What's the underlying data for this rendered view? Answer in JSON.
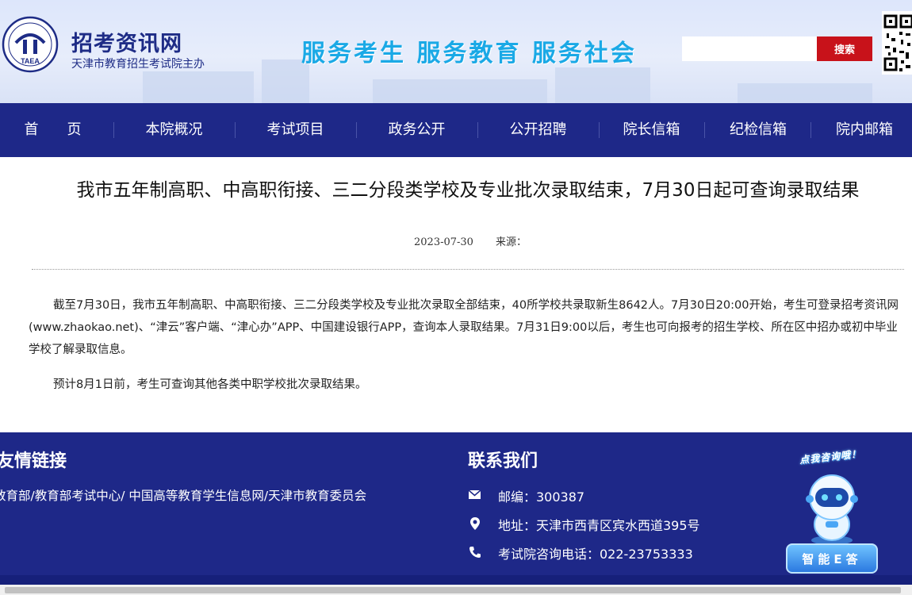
{
  "header": {
    "site_name": "招考资讯网",
    "site_subtitle": "天津市教育招生考试院主办",
    "logo_text": "TAEA",
    "slogan": "服务考生  服务教育  服务社会",
    "search": {
      "placeholder": "",
      "button_label": "搜索"
    }
  },
  "nav": {
    "items": [
      {
        "label": "首　　页"
      },
      {
        "label": "本院概况"
      },
      {
        "label": "考试项目"
      },
      {
        "label": "政务公开"
      },
      {
        "label": "公开招聘"
      },
      {
        "label": "院长信箱"
      },
      {
        "label": "纪检信箱"
      },
      {
        "label": "院内邮箱"
      }
    ]
  },
  "article": {
    "title": "我市五年制高职、中高职衔接、三二分段类学校及专业批次录取结束，7月30日起可查询录取结果",
    "date": "2023-07-30",
    "source_label": "来源：",
    "paragraphs": [
      "截至7月30日，我市五年制高职、中高职衔接、三二分段类学校及专业批次录取全部结束，40所学校共录取新生8642人。7月30日20:00开始，考生可登录招考资讯网(www.zhaokao.net)、“津云”客户端、“津心办”APP、中国建设银行APP，查询本人录取结果。7月31日9:00以后，考生也可向报考的招生学校、所在区中招办或初中毕业学校了解录取信息。",
      "预计8月1日前，考生可查询其他各类中职学校批次录取结果。"
    ]
  },
  "footer": {
    "links_title": "友情链接",
    "links_text": "教育部/教育部考试中心/ 中国高等教育学生信息网/天津市教育委员会",
    "contact_title": "联系我们",
    "contacts": [
      {
        "icon": "mail-icon",
        "text": "邮编：300387"
      },
      {
        "icon": "location-pin-icon",
        "text": "地址：天津市西青区宾水西道395号"
      },
      {
        "icon": "phone-icon",
        "text": "考试院咨询电话：022-23753333"
      }
    ],
    "bot_bubble": "点我咨询哦！",
    "bot_button": "智能E答"
  }
}
